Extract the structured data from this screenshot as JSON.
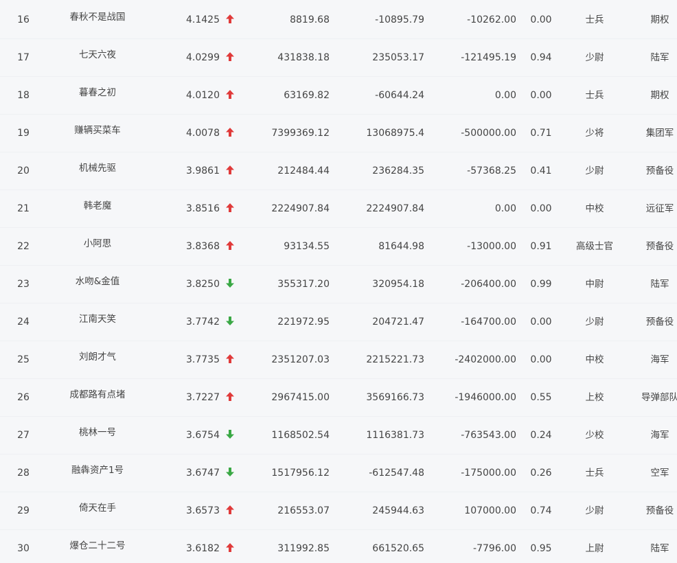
{
  "colors": {
    "up": "#e03a3a",
    "down": "#3aa845",
    "text": "#444444",
    "bg": "#f6f7f9"
  },
  "rows": [
    {
      "rank": "16",
      "name": "春秋不是战国",
      "score": "4.1425",
      "trend": "up",
      "v1": "8819.68",
      "v2": "-10895.79",
      "v3": "-10262.00",
      "ratio": "0.00",
      "rank_name": "士兵",
      "group": "期权"
    },
    {
      "rank": "17",
      "name": "七天六夜",
      "score": "4.0299",
      "trend": "up",
      "v1": "431838.18",
      "v2": "235053.17",
      "v3": "-121495.19",
      "ratio": "0.94",
      "rank_name": "少尉",
      "group": "陆军"
    },
    {
      "rank": "18",
      "name": "暮春之初",
      "score": "4.0120",
      "trend": "up",
      "v1": "63169.82",
      "v2": "-60644.24",
      "v3": "0.00",
      "ratio": "0.00",
      "rank_name": "士兵",
      "group": "期权"
    },
    {
      "rank": "19",
      "name": "赚辆买菜车",
      "score": "4.0078",
      "trend": "up",
      "v1": "7399369.12",
      "v2": "13068975.4",
      "v3": "-500000.00",
      "ratio": "0.71",
      "rank_name": "少将",
      "group": "集团军"
    },
    {
      "rank": "20",
      "name": "机械先驱",
      "score": "3.9861",
      "trend": "up",
      "v1": "212484.44",
      "v2": "236284.35",
      "v3": "-57368.25",
      "ratio": "0.41",
      "rank_name": "少尉",
      "group": "预备役"
    },
    {
      "rank": "21",
      "name": "韩老魔",
      "score": "3.8516",
      "trend": "up",
      "v1": "2224907.84",
      "v2": "2224907.84",
      "v3": "0.00",
      "ratio": "0.00",
      "rank_name": "中校",
      "group": "远征军"
    },
    {
      "rank": "22",
      "name": "小阿思",
      "score": "3.8368",
      "trend": "up",
      "v1": "93134.55",
      "v2": "81644.98",
      "v3": "-13000.00",
      "ratio": "0.91",
      "rank_name": "高级士官",
      "group": "预备役"
    },
    {
      "rank": "23",
      "name": "水吻&金值",
      "score": "3.8250",
      "trend": "down",
      "v1": "355317.20",
      "v2": "320954.18",
      "v3": "-206400.00",
      "ratio": "0.99",
      "rank_name": "中尉",
      "group": "陆军"
    },
    {
      "rank": "24",
      "name": "江南天笑",
      "score": "3.7742",
      "trend": "down",
      "v1": "221972.95",
      "v2": "204721.47",
      "v3": "-164700.00",
      "ratio": "0.00",
      "rank_name": "少尉",
      "group": "预备役"
    },
    {
      "rank": "25",
      "name": "刘朗才气",
      "score": "3.7735",
      "trend": "up",
      "v1": "2351207.03",
      "v2": "2215221.73",
      "v3": "-2402000.00",
      "ratio": "0.00",
      "rank_name": "中校",
      "group": "海军"
    },
    {
      "rank": "26",
      "name": "成都路有点堵",
      "score": "3.7227",
      "trend": "up",
      "v1": "2967415.00",
      "v2": "3569166.73",
      "v3": "-1946000.00",
      "ratio": "0.55",
      "rank_name": "上校",
      "group": "导弹部队"
    },
    {
      "rank": "27",
      "name": "桃林一号",
      "score": "3.6754",
      "trend": "down",
      "v1": "1168502.54",
      "v2": "1116381.73",
      "v3": "-763543.00",
      "ratio": "0.24",
      "rank_name": "少校",
      "group": "海军"
    },
    {
      "rank": "28",
      "name": "融犇资产1号",
      "score": "3.6747",
      "trend": "down",
      "v1": "1517956.12",
      "v2": "-612547.48",
      "v3": "-175000.00",
      "ratio": "0.26",
      "rank_name": "士兵",
      "group": "空军"
    },
    {
      "rank": "29",
      "name": "倚天在手",
      "score": "3.6573",
      "trend": "up",
      "v1": "216553.07",
      "v2": "245944.63",
      "v3": "107000.00",
      "ratio": "0.74",
      "rank_name": "少尉",
      "group": "预备役"
    },
    {
      "rank": "30",
      "name": "爆仓二十二号",
      "score": "3.6182",
      "trend": "up",
      "v1": "311992.85",
      "v2": "661520.65",
      "v3": "-7796.00",
      "ratio": "0.95",
      "rank_name": "上尉",
      "group": "陆军"
    }
  ]
}
